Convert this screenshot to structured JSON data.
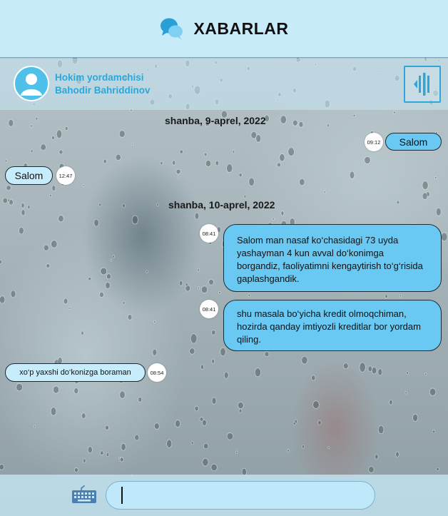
{
  "header": {
    "title": "XABARLAR",
    "logo_icon": "chat-bubbles-icon"
  },
  "contact": {
    "name_line1": "Hokim yordamchisi",
    "name_line2": "Bahodir Bahriddinov",
    "avatar_icon": "user-avatar-icon",
    "panel_icon": "collapse-panel-icon"
  },
  "conversation": {
    "date1": "shanba, 9-aprel, 2022",
    "date2": "shanba, 10-aprel, 2022",
    "messages": [
      {
        "direction": "out",
        "text": "Salom",
        "time": "09:12"
      },
      {
        "direction": "in",
        "text": "Salom",
        "time": "12:47"
      },
      {
        "direction": "out",
        "text": "Salom man nasaf ko‘chasidagi 73 uyda yashayman 4 kun avval do‘konimga borgandiz, faoliyatimni kengaytirish to‘g‘risida gaplashgandik.",
        "time": "08:41"
      },
      {
        "direction": "out",
        "text": "shu masala bo‘yicha kredit olmoqchiman, hozirda qanday imtiyozli kreditlar bor yordam qiling.",
        "time": "08:41"
      },
      {
        "direction": "in",
        "text": "xo‘p yaxshi do‘konizga boraman",
        "time": "08:54"
      }
    ]
  },
  "composer": {
    "value": "",
    "placeholder": "",
    "keyboard_icon": "keyboard-icon"
  },
  "colors": {
    "header_bg": "#c8ebfa",
    "accent": "#2ea7d8",
    "outgoing_bubble": "#69c9f3",
    "incoming_bubble": "#c7ecfb"
  }
}
